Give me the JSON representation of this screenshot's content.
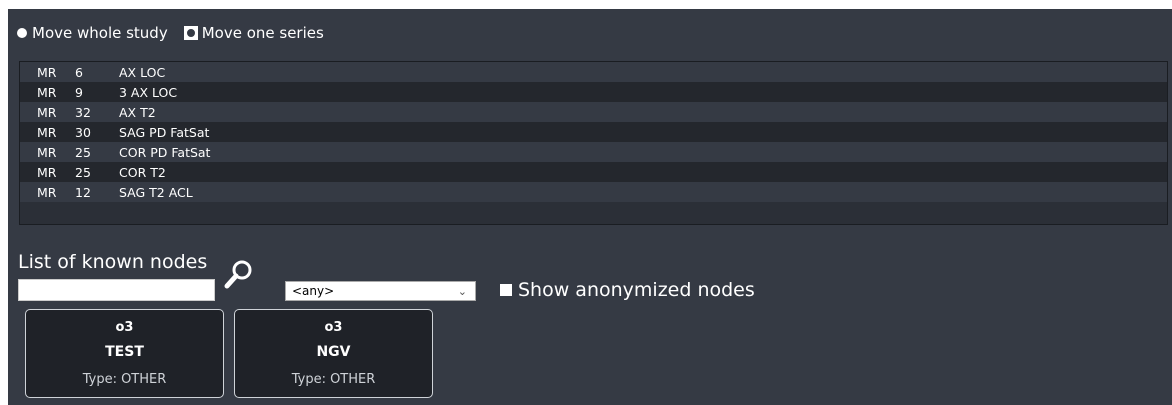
{
  "move_options": [
    {
      "label": "Move whole study",
      "selected": false
    },
    {
      "label": "Move one series",
      "selected": true
    }
  ],
  "series": [
    {
      "modality": "MR",
      "count": "6",
      "description": "AX LOC"
    },
    {
      "modality": "MR",
      "count": "9",
      "description": "3 AX LOC"
    },
    {
      "modality": "MR",
      "count": "32",
      "description": "AX T2"
    },
    {
      "modality": "MR",
      "count": "30",
      "description": "SAG PD FatSat"
    },
    {
      "modality": "MR",
      "count": "25",
      "description": "COR PD FatSat"
    },
    {
      "modality": "MR",
      "count": "25",
      "description": "COR T2"
    },
    {
      "modality": "MR",
      "count": "12",
      "description": "SAG T2 ACL"
    }
  ],
  "nodes_section": {
    "title": "List of known nodes",
    "search_value": "",
    "filter_selected": "<any>",
    "show_anonymized_label": "Show anonymized nodes",
    "search_icon": "magnifier-icon"
  },
  "nodes": [
    {
      "name": "o3",
      "ae_title": "TEST",
      "type": "Type: OTHER"
    },
    {
      "name": "o3",
      "ae_title": "NGV",
      "type": "Type: OTHER"
    }
  ],
  "colors": {
    "panel_bg": "#353a44",
    "row_dark": "#24272d",
    "card_bg": "#1f2228"
  }
}
